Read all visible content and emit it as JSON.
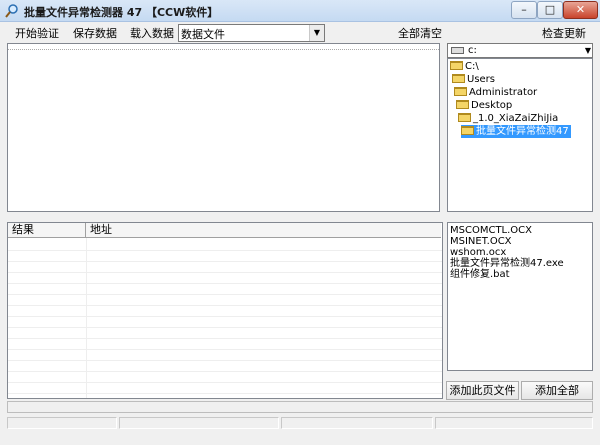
{
  "window": {
    "title": "批量文件异常检测器 47 【CCW软件】",
    "controls": {
      "minimize": "–",
      "maximize": "□",
      "close": "✕"
    }
  },
  "toolbar": {
    "start_label": "开始验证",
    "save_label": "保存数据",
    "load_label": "载入数据",
    "combo_value": "数据文件",
    "clear_label": "全部清空",
    "update_label": "检查更新"
  },
  "drive": {
    "value": "c:"
  },
  "tree": [
    {
      "label": "C:\\",
      "selected": false
    },
    {
      "label": "Users",
      "selected": false
    },
    {
      "label": "Administrator",
      "selected": false
    },
    {
      "label": "Desktop",
      "selected": false
    },
    {
      "label": "_1.0_XiaZaiZhiJia",
      "selected": false
    },
    {
      "label": "批量文件异常检测47",
      "selected": true
    }
  ],
  "results": {
    "columns": [
      "结果",
      "地址"
    ],
    "rows": []
  },
  "files": [
    "MSCOMCTL.OCX",
    "MSINET.OCX",
    "wshom.ocx",
    "批量文件异常检测47.exe",
    "组件修复.bat"
  ],
  "buttons": {
    "add_page": "添加此页文件",
    "add_all": "添加全部"
  },
  "colors": {
    "selection": "#3399ff",
    "folder": "#f4d567"
  }
}
